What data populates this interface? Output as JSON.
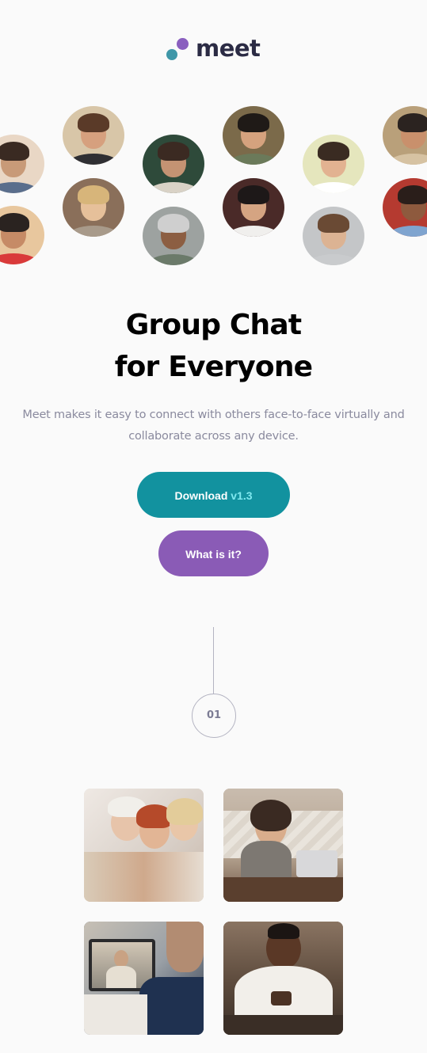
{
  "brand": {
    "name": "meet",
    "colors": {
      "teal": "#3f97a8",
      "purple": "#8a5fbf",
      "text": "#2b2b44"
    }
  },
  "avatars": [
    {
      "name": "avatar-1",
      "palette": [
        "#e9d7c5",
        "#c89a78",
        "#3a2a22",
        "#5a6e8c"
      ]
    },
    {
      "name": "avatar-2",
      "palette": [
        "#d8c6a8",
        "#d6a07e",
        "#5a3a28",
        "#2f2f33"
      ]
    },
    {
      "name": "avatar-3",
      "palette": [
        "#2e4a3a",
        "#c49373",
        "#3b2a22",
        "#d9d2c6"
      ]
    },
    {
      "name": "avatar-4",
      "palette": [
        "#7b6a4a",
        "#d5a27e",
        "#1f1a17",
        "#6b7a5a"
      ]
    },
    {
      "name": "avatar-5",
      "palette": [
        "#e5e6bd",
        "#e2b291",
        "#3a2b22",
        "#ffffff"
      ]
    },
    {
      "name": "avatar-6",
      "palette": [
        "#b9a07a",
        "#c9906c",
        "#2b2320",
        "#d6c2a2"
      ]
    },
    {
      "name": "avatar-7",
      "palette": [
        "#e8c79e",
        "#c68b66",
        "#2a2320",
        "#d93a3a"
      ]
    },
    {
      "name": "avatar-8",
      "palette": [
        "#8a6f5a",
        "#e6c09a",
        "#d7b57a",
        "#a89a8a"
      ]
    },
    {
      "name": "avatar-9",
      "palette": [
        "#9da2a0",
        "#8c5e42",
        "#cfcfcf",
        "#6b7a6a"
      ]
    },
    {
      "name": "avatar-10",
      "palette": [
        "#4a2a28",
        "#d5a482",
        "#1d1818",
        "#f0efed"
      ]
    },
    {
      "name": "avatar-11",
      "palette": [
        "#c4c6c8",
        "#dcb393",
        "#6a4a34",
        "#c9cbcd"
      ]
    },
    {
      "name": "avatar-12",
      "palette": [
        "#b53a30",
        "#8e5a3e",
        "#2a1e1a",
        "#7fa4cf"
      ]
    }
  ],
  "hero": {
    "title_line1": "Group Chat",
    "title_line2": "for Everyone",
    "subtitle": "Meet makes it easy to connect with others face-to-face virtually and collaborate across any device."
  },
  "buttons": {
    "download_label": "Download",
    "download_version": "v1.3",
    "what_label": "What is it?"
  },
  "step": {
    "number": "01"
  },
  "photos": [
    {
      "name": "photo-women-group"
    },
    {
      "name": "photo-woman-laptop"
    },
    {
      "name": "photo-video-call"
    },
    {
      "name": "photo-man-phone"
    }
  ]
}
